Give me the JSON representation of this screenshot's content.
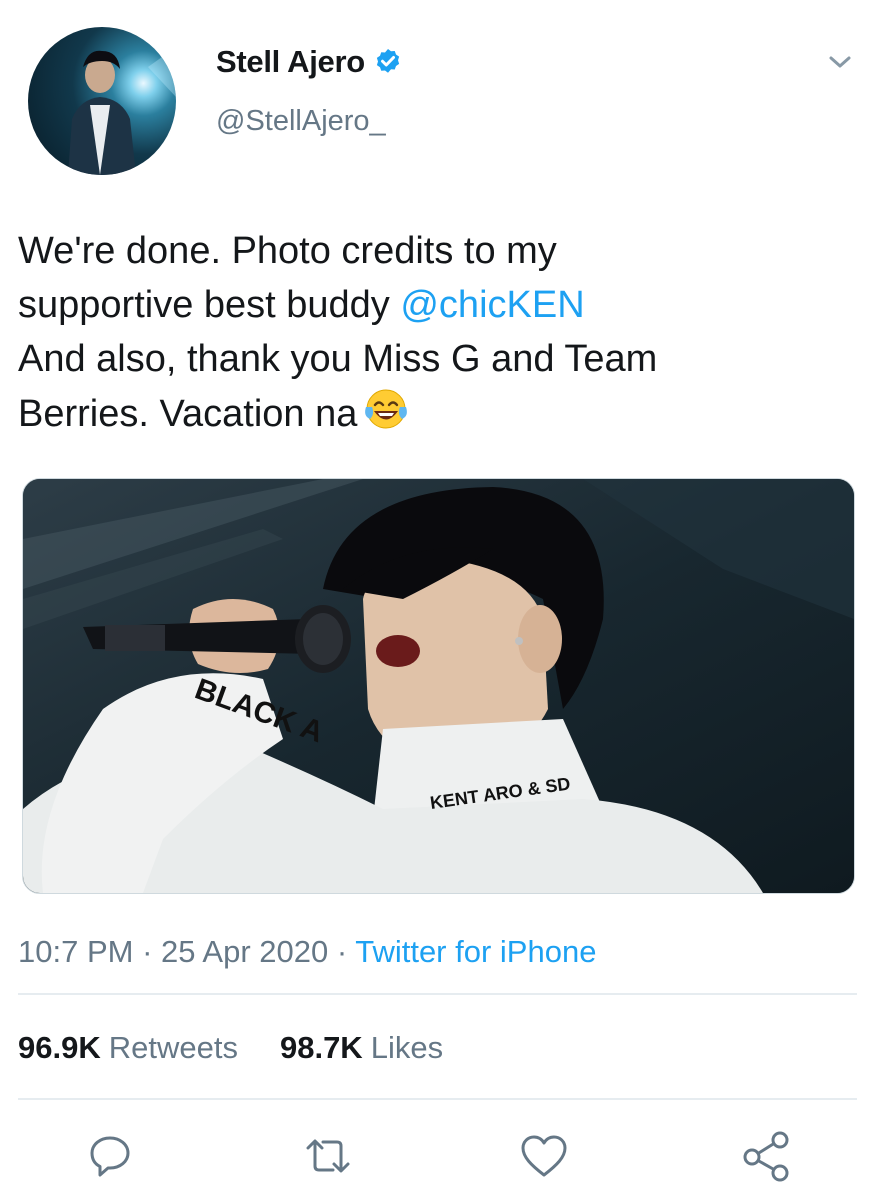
{
  "author": {
    "display_name": "Stell Ajero",
    "handle": "@StellAjero_",
    "verified": true
  },
  "tweet": {
    "text_before": "We're done. Photo credits to my\nsupportive best buddy ",
    "mention": "@chicKEN",
    "text_after": "\nAnd also, thank you Miss G and Team\nBerries. Vacation na",
    "emoji": "face-with-tears-of-joy"
  },
  "media": {
    "shirt_text": "KENT ARO & SD",
    "sleeve_text": "BLACK A"
  },
  "meta": {
    "time": "10:7 PM",
    "separator1": " · ",
    "date": "25 Apr 2020",
    "separator2": " · ",
    "source": "Twitter for iPhone"
  },
  "stats": {
    "retweets_count": "96.9K",
    "retweets_label": "Retweets",
    "likes_count": "98.7K",
    "likes_label": "Likes"
  },
  "actions": [
    "reply-icon",
    "retweet-icon",
    "like-icon",
    "share-icon"
  ],
  "colors": {
    "accent": "#1da1f2",
    "text": "#14171a",
    "secondary": "#657786",
    "divider": "#e6ecf0"
  }
}
